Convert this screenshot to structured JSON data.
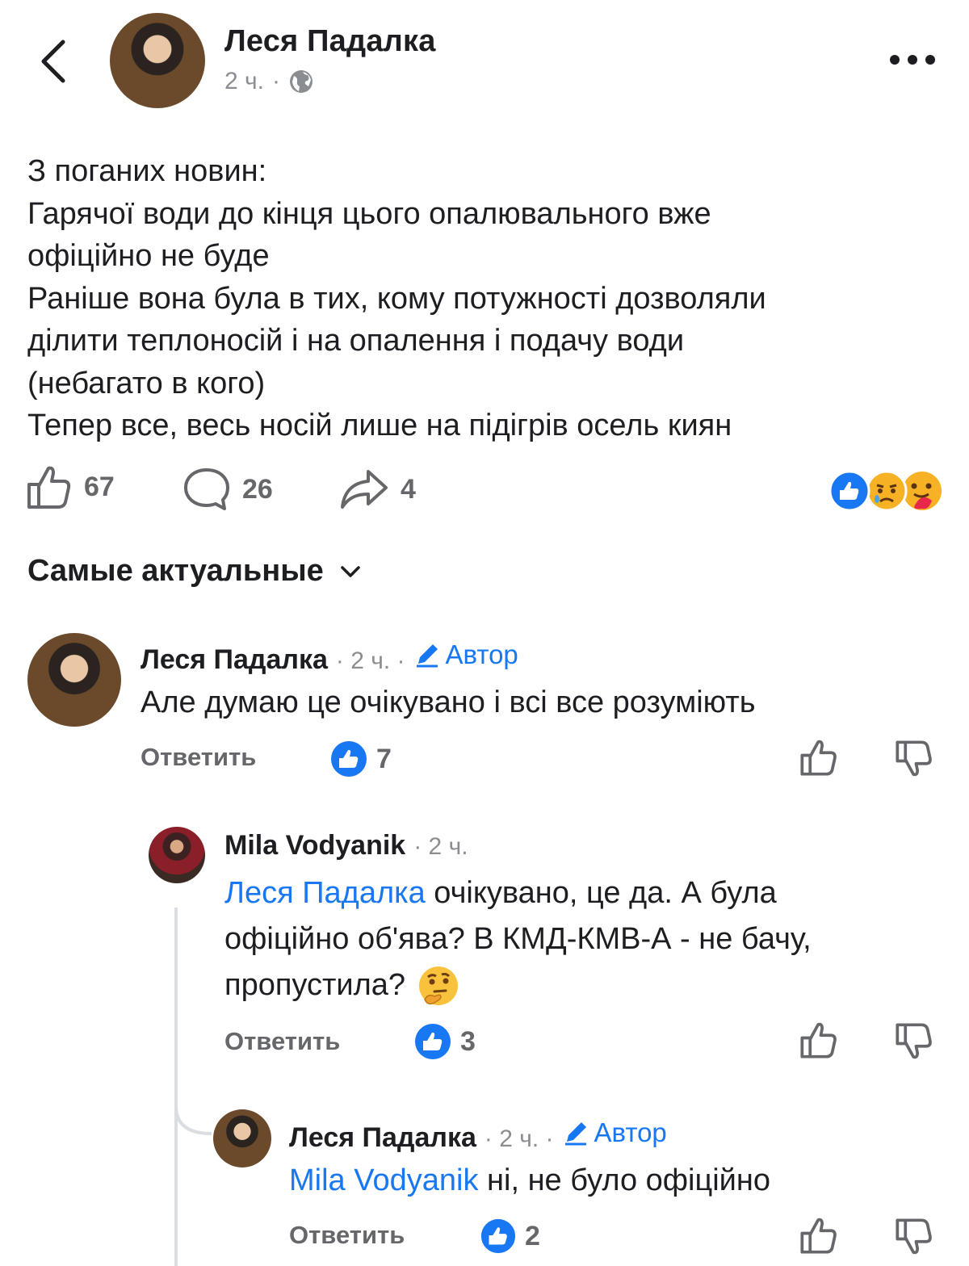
{
  "header": {
    "author_name": "Леся Падалка",
    "time": "2 ч.",
    "dot": "·",
    "icons": [
      "back-chevron-icon",
      "globe-icon",
      "more-dots-icon"
    ]
  },
  "post": {
    "lines": [
      "З поганих новин:",
      "Гарячої води до кінця цього опалювального вже",
      "офіційно не буде",
      "Раніше вона була в тих, кому потужності дозволяли",
      "ділити теплоносій і на опалення і подачу води",
      "(небагато в кого)",
      "Тепер все, весь носій лише на підігрів осель киян"
    ],
    "likes": "67",
    "comments": "26",
    "shares": "4",
    "reactions": [
      "like-reaction-icon",
      "sad-reaction-icon",
      "care-reaction-icon"
    ]
  },
  "sort": {
    "label": "Самые актуальные"
  },
  "comments": [
    {
      "name": "Леся Падалка",
      "time": "2 ч.",
      "author_badge": "Автор",
      "text": "Але думаю це очікувано і всі все розуміють",
      "reply_label": "Ответить",
      "like_count": "7"
    },
    {
      "name": "Mila Vodyanik",
      "time": "2 ч.",
      "mention": "Леся Падалка",
      "text_line1": " очікувано, це да. А була",
      "text_line2": "офіційно об'ява? В КМД-КМВ-А - не бачу,",
      "text_line3": "пропустила?",
      "reply_label": "Ответить",
      "like_count": "3"
    },
    {
      "name": "Леся Падалка",
      "time": "2 ч.",
      "author_badge": "Автор",
      "mention": "Mila Vodyanik",
      "text": " ні, не було офіційно",
      "reply_label": "Ответить",
      "like_count": "2"
    }
  ],
  "colors": {
    "accent": "#1877f2",
    "text": "#1c1e21",
    "muted": "#8a8d91",
    "icon": "#65676b"
  }
}
